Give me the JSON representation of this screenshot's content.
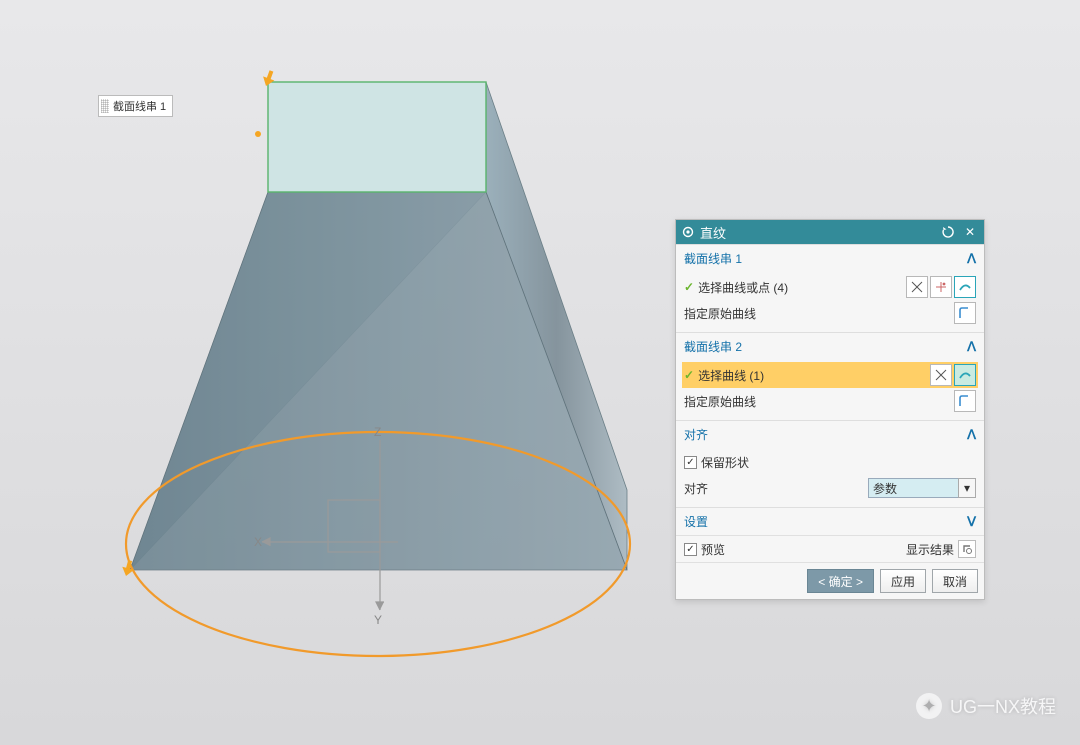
{
  "scene": {
    "label": "截面线串 1",
    "axes": {
      "x": "X",
      "y": "Y",
      "z": "Z"
    },
    "arrows": [
      "top-left-arrow",
      "bottom-left-arrow"
    ]
  },
  "dialog": {
    "title": "直纹",
    "section1": {
      "title": "截面线串 1",
      "select_label": "选择曲线或点 (4)",
      "spec_label": "指定原始曲线"
    },
    "section2": {
      "title": "截面线串 2",
      "select_label": "选择曲线 (1)",
      "spec_label": "指定原始曲线"
    },
    "align": {
      "title": "对齐",
      "keep_shape": "保留形状",
      "align_label": "对齐",
      "align_value": "参数"
    },
    "settings": {
      "title": "设置"
    },
    "preview": {
      "preview_label": "预览",
      "result_label": "显示结果"
    },
    "buttons": {
      "ok": "< 确定 >",
      "apply": "应用",
      "cancel": "取消"
    }
  },
  "watermark": "UG一NX教程"
}
